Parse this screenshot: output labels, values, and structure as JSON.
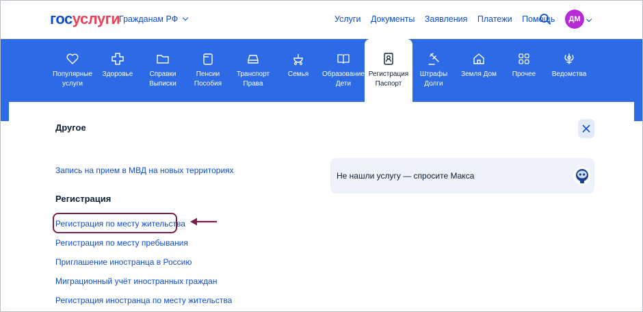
{
  "header": {
    "logo_part1": "гос",
    "logo_part2": "услуги",
    "region": "Гражданам РФ",
    "nav": [
      "Услуги",
      "Документы",
      "Заявления",
      "Платежи",
      "Помощь"
    ],
    "user_initials": "ДМ"
  },
  "categories": [
    {
      "line1": "Популярные",
      "line2": "услуги",
      "icon": "heart-icon"
    },
    {
      "line1": "Здоровье",
      "line2": "",
      "icon": "health-cross-icon"
    },
    {
      "line1": "Справки",
      "line2": "Выписки",
      "icon": "folder-icon"
    },
    {
      "line1": "Пенсии",
      "line2": "Пособия",
      "icon": "wallet-icon"
    },
    {
      "line1": "Транспорт",
      "line2": "Права",
      "icon": "car-icon"
    },
    {
      "line1": "Семья",
      "line2": "",
      "icon": "stroller-icon"
    },
    {
      "line1": "Образование",
      "line2": "Дети",
      "icon": "book-icon"
    },
    {
      "line1": "Регистрация",
      "line2": "Паспорт",
      "icon": "passport-icon",
      "active": true
    },
    {
      "line1": "Штрафы",
      "line2": "Долги",
      "icon": "gavel-icon"
    },
    {
      "line1": "Земля Дом",
      "line2": "",
      "icon": "house-icon"
    },
    {
      "line1": "Прочее",
      "line2": "",
      "icon": "grid-icon"
    },
    {
      "line1": "Ведомства",
      "line2": "",
      "icon": "emblem-icon"
    }
  ],
  "panel": {
    "title": "Другое",
    "top_link": "Запись на прием в МВД на новых территориях",
    "section_title": "Регистрация",
    "links": [
      "Регистрация по месту жительства",
      "Регистрация по месту пребывания",
      "Приглашение иностранца в Россию",
      "Миграционный учёт иностранных граждан",
      "Регистрация иностранца по месту жительства"
    ],
    "ask": "Не нашли услугу — спросите Макса"
  },
  "colors": {
    "brand_blue": "#0d4cd3",
    "band_blue": "#2d6be6",
    "logo_red": "#ee3f58",
    "avatar": "#b52bd4",
    "highlight": "#7a1f47"
  }
}
